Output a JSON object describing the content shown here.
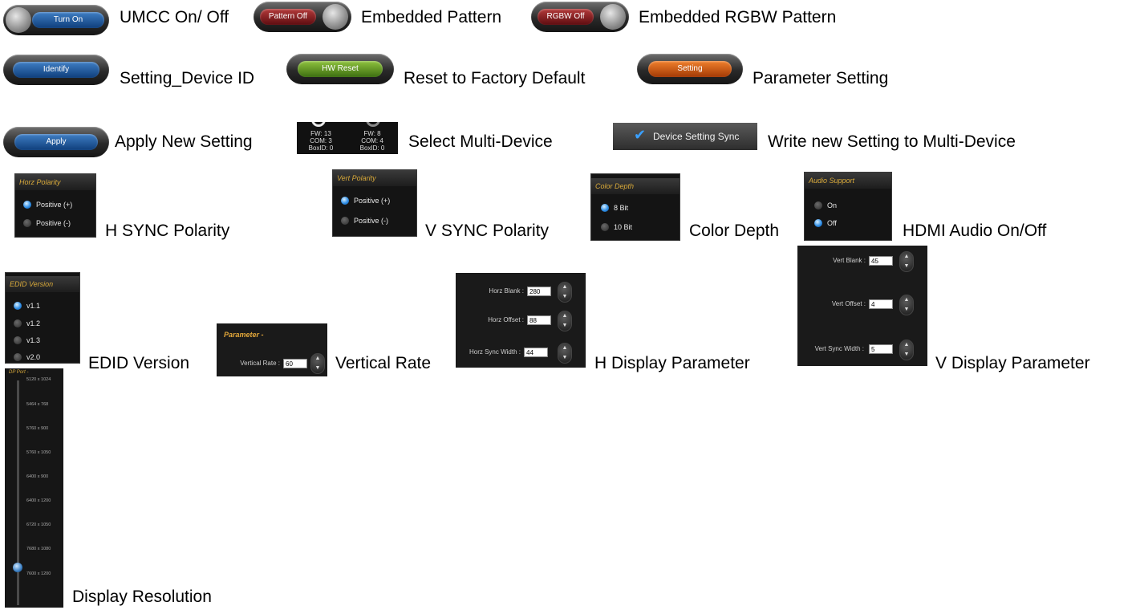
{
  "rows": {
    "r1": {
      "turn_on": "Turn On",
      "cap1": "UMCC On/ Off",
      "pattern_off": "Pattern Off",
      "cap2": "Embedded Pattern",
      "rgbw_off": "RGBW Off",
      "cap3": "Embedded RGBW Pattern"
    },
    "r2": {
      "identify": "Identify",
      "cap1": "Setting_Device ID",
      "hw_reset": "HW Reset",
      "cap2": "Reset to Factory Default",
      "setting": "Setting",
      "cap3": "Parameter Setting"
    },
    "r3": {
      "apply": "Apply",
      "cap1": "Apply New Setting",
      "dev1": {
        "fw": "FW: 13",
        "com": "COM: 3",
        "box": "BoxID: 0"
      },
      "dev2": {
        "fw": "FW: 8",
        "com": "COM: 4",
        "box": "BoxID: 0"
      },
      "cap2": "Select Multi-Device",
      "sync_label": "Device Setting Sync",
      "cap3": "Write new Setting to Multi-Device"
    },
    "r4": {
      "horz_title": "Horz Polarity",
      "horz_opt1": "Positive (+)",
      "horz_opt2": "Positive (-)",
      "cap1": "H SYNC Polarity",
      "vert_title": "Vert Polarity",
      "vert_opt1": "Positive (+)",
      "vert_opt2": "Positive (-)",
      "cap2": "V SYNC Polarity",
      "depth_title": "Color Depth",
      "depth_opt1": "8 Bit",
      "depth_opt2": "10 Bit",
      "cap3": "Color Depth",
      "audio_title": "Audio Support",
      "audio_opt1": "On",
      "audio_opt2": "Off",
      "cap4": "HDMI Audio On/Off"
    },
    "r5": {
      "edid_title": "EDID Version",
      "edid_opts": [
        "v1.1",
        "v1.2",
        "v1.3",
        "v2.0"
      ],
      "cap1": "EDID Version",
      "param_title": "Parameter -",
      "vrate_label": "Vertical Rate :",
      "vrate_value": "60",
      "cap2": "Vertical Rate",
      "hblank_label": "Horz Blank :",
      "hblank_value": "280",
      "hoffset_label": "Horz Offset :",
      "hoffset_value": "88",
      "hsync_label": "Horz Sync Width :",
      "hsync_value": "44",
      "cap3": "H Display Parameter",
      "vblank_label": "Vert Blank :",
      "vblank_value": "45",
      "voffset_label": "Vert Offset :",
      "voffset_value": "4",
      "vsync_label": "Vert Sync Width :",
      "vsync_value": "5",
      "cap4": "V Display Parameter"
    },
    "r6": {
      "dp_title": "DP Port -",
      "resolutions": [
        "5120 x 1024",
        "5464 x 768",
        "5760 x 900",
        "5760 x 1050",
        "6400 x 900",
        "6400 x 1200",
        "6720 x 1050",
        "7680 x 1080",
        "7600 x 1200"
      ],
      "cap1": "Display Resolution"
    }
  },
  "colors": {
    "accent_blue": "#2f8ee6",
    "title_gold": "#d8a93a"
  }
}
